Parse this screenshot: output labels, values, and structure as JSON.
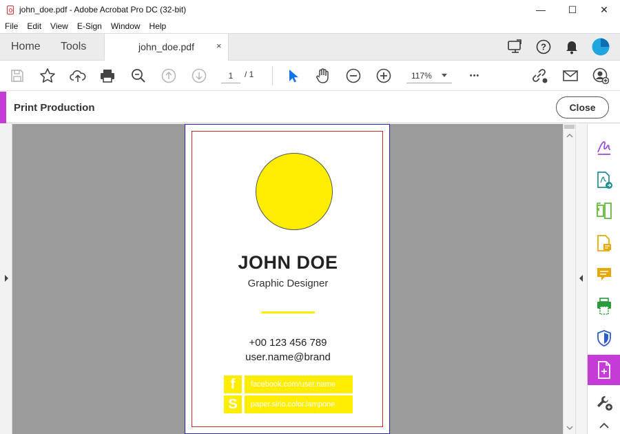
{
  "window": {
    "title": "john_doe.pdf - Adobe Acrobat Pro DC (32-bit)",
    "minimize_glyph": "—",
    "maximize_glyph": "☐",
    "close_glyph": "✕"
  },
  "menu": [
    "File",
    "Edit",
    "View",
    "E-Sign",
    "Window",
    "Help"
  ],
  "tabs": {
    "home": "Home",
    "tools": "Tools",
    "document": "john_doe.pdf",
    "document_close": "×"
  },
  "toolbar": {
    "current_page": "1",
    "page_total": "/ 1",
    "zoom": "117%",
    "more": "•••"
  },
  "tool_panel": {
    "title": "Print Production",
    "close_label": "Close",
    "accent_color": "#c43bd6"
  },
  "document": {
    "name": "JOHN DOE",
    "role": "Graphic Designer",
    "phone": "+00 123 456 789",
    "email": "user.name@brand",
    "social": [
      {
        "icon_letter": "f",
        "text": "facebook.com/user.name"
      },
      {
        "icon_letter": "S",
        "text": "paper.sirio.color.lampone"
      }
    ],
    "accent_color": "#ffed00"
  },
  "right_panel_tools": [
    "fill-sign-icon",
    "export-pdf-icon",
    "organize-pages-icon",
    "edit-pdf-icon",
    "comment-icon",
    "print-production-icon",
    "protect-icon",
    "create-pdf-icon",
    "more-tools-icon"
  ]
}
